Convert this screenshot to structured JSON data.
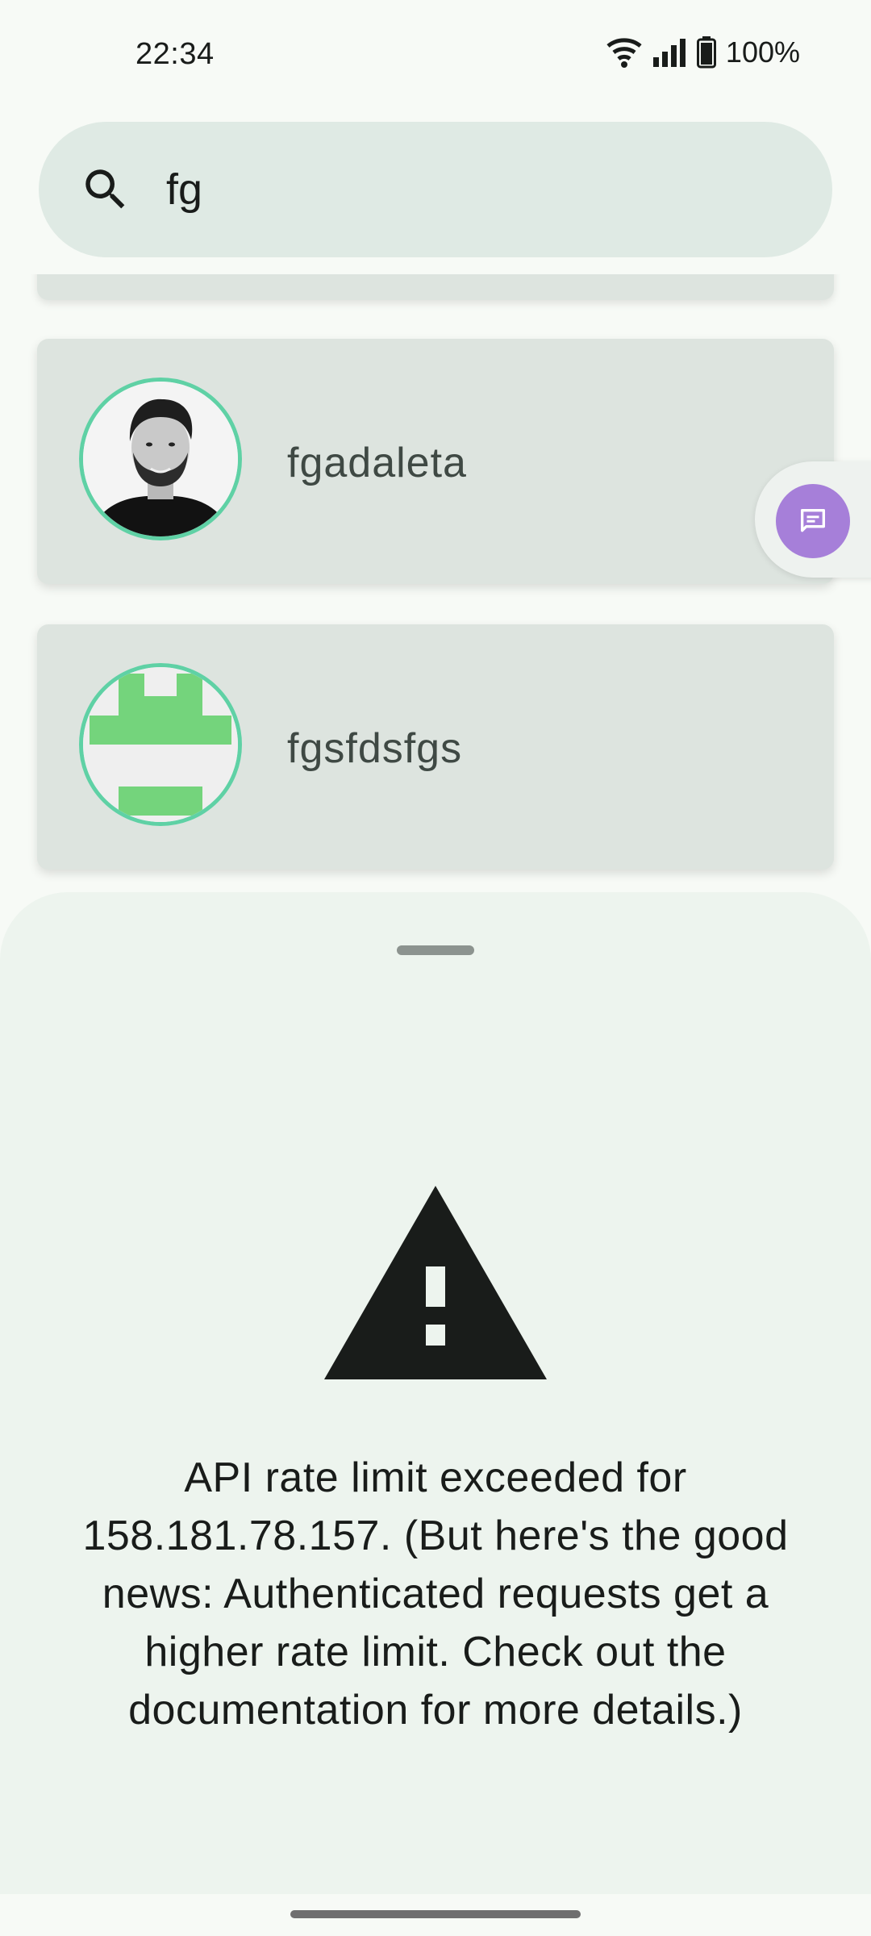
{
  "status_bar": {
    "time": "22:34",
    "battery": "100%",
    "icons": [
      "wifi-icon",
      "cellular-signal-icon",
      "battery-icon"
    ]
  },
  "search": {
    "query": "fg",
    "icon": "search-icon"
  },
  "users": [
    {
      "login": "fgadaleta",
      "avatar": "photo-avatar"
    },
    {
      "login": "fgsfdsfgs",
      "avatar": "identicon-avatar"
    }
  ],
  "chat_button": {
    "icon": "chat-bubble-icon"
  },
  "error_sheet": {
    "icon": "warning-icon",
    "message": "API rate limit exceeded for 158.181.78.157. (But here's the good news: Authenticated requests get a higher rate limit. Check out the documentation for more details.)"
  },
  "colors": {
    "accent": "#5fd1a5",
    "identicon": "#74d47c",
    "chat_button": "#a67fd9",
    "card": "#dde4df",
    "sheet": "#edf4ee"
  }
}
